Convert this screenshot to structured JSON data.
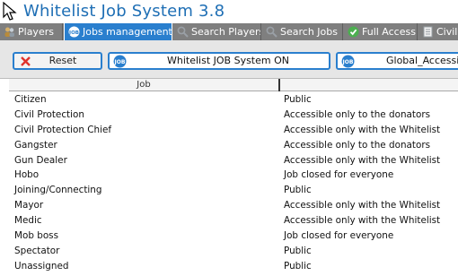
{
  "app": {
    "title": "Whitelist Job System 3.8"
  },
  "tabs": [
    {
      "label": "Players",
      "icon": "players-icon"
    },
    {
      "label": "Jobs management",
      "icon": "jobs-icon",
      "active": true
    },
    {
      "label": "Search Players",
      "icon": "search-icon"
    },
    {
      "label": "Search Jobs",
      "icon": "search-icon"
    },
    {
      "label": "Full Access",
      "icon": "check-icon"
    },
    {
      "label": "Civil",
      "icon": "document-icon"
    }
  ],
  "toolbar": {
    "reset_label": "Reset",
    "status_value": "Whitelist JOB System ON",
    "access_value": "Global_Accessi"
  },
  "grid": {
    "columns": [
      "Job",
      ""
    ],
    "rows": [
      {
        "job": "Citizen",
        "access": "Public"
      },
      {
        "job": "Civil Protection",
        "access": "Accessible only to the donators"
      },
      {
        "job": "Civil Protection Chief",
        "access": "Accessible only with the Whitelist"
      },
      {
        "job": "Gangster",
        "access": "Accessible only to the donators"
      },
      {
        "job": "Gun Dealer",
        "access": "Accessible only with the Whitelist"
      },
      {
        "job": "Hobo",
        "access": "Job closed for everyone"
      },
      {
        "job": "Joining/Connecting",
        "access": "Public"
      },
      {
        "job": "Mayor",
        "access": "Accessible only with the Whitelist"
      },
      {
        "job": "Medic",
        "access": "Accessible only with the Whitelist"
      },
      {
        "job": "Mob boss",
        "access": "Job closed for everyone"
      },
      {
        "job": "Spectator",
        "access": "Public"
      },
      {
        "job": "Unassigned",
        "access": "Public"
      }
    ]
  },
  "colors": {
    "accent": "#2a7fce",
    "tabstrip": "#7f7f7f",
    "title": "#1f6fb5"
  }
}
